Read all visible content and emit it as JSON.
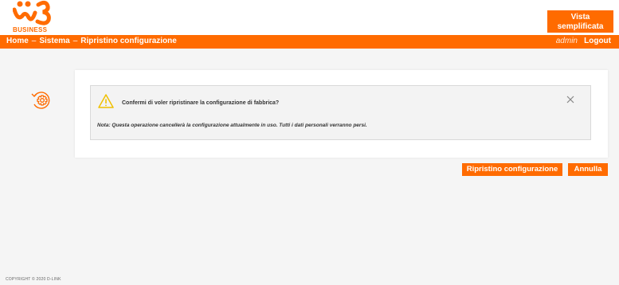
{
  "brand": {
    "label": "BUSINESS"
  },
  "header": {
    "simple_view_label_line1": "Vista",
    "simple_view_label_line2": "semplificata"
  },
  "breadcrumb": [
    {
      "label": "Home"
    },
    {
      "label": "Sistema"
    },
    {
      "label": "Ripristino configurazione"
    }
  ],
  "breadcrumb_separator": "–",
  "nav": {
    "user": "admin",
    "logout_label": "Logout"
  },
  "dialog": {
    "question": "Confermi di voler ripristinare la configurazione di fabbrica?",
    "note": "Nota: Questa operazione cancellerà la configurazione attualmente in uso. Tutti i dati personali verranno persi."
  },
  "actions": {
    "restore_label": "Ripristino configurazione",
    "cancel_label": "Annulla"
  },
  "footer": {
    "copyright": "COPYRIGHT © 2020 D-LINK"
  },
  "colors": {
    "accent": "#ff6b00",
    "background": "#f5f5f5"
  },
  "icons": [
    "brand-logo-icon",
    "settings-restore-icon",
    "warning-icon",
    "close-icon"
  ]
}
